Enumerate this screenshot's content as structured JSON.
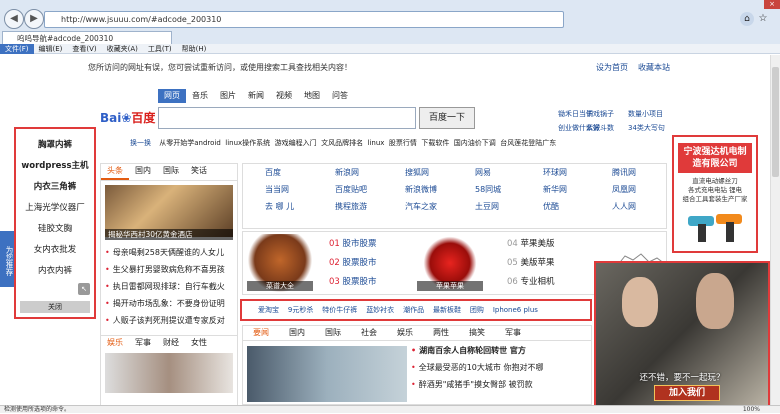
{
  "browser": {
    "url": "http://www.jsuuu.com/#adcode_200310",
    "tab_title": "呜呜导航#adcode_200310",
    "close": "×",
    "menu": [
      "文件(F)",
      "编辑(E)",
      "查看(V)",
      "收藏夹(A)",
      "工具(T)",
      "帮助(H)"
    ],
    "status": "检测使用所选项的命令。",
    "zoom": "100%"
  },
  "notice": "您所访问的网址有误，您可尝试重新访问，或使用搜索工具查找相关内容！",
  "top_links": [
    "设为首页",
    "收藏本站"
  ],
  "search": {
    "tabs": [
      "网页",
      "音乐",
      "图片",
      "新闻",
      "视频",
      "地图",
      "问答"
    ],
    "button": "百度一下",
    "logo": "百度",
    "side": [
      "锄禾日当午",
      "调戏锅子",
      "数量小项目",
      "创业做什么好",
      "紫微斗数",
      "34类大写句"
    ],
    "hot_label": "换一换",
    "hot": [
      "从零开始学android",
      "linux操作系统",
      "游戏编程入门",
      "文风品牌排名",
      "linux",
      "股票行情",
      "下载软件",
      "国内油价下调",
      "台风莲花登陆广东"
    ]
  },
  "left_ad": {
    "items": [
      "胸罩内裤",
      "wordpress主机",
      "内衣三角裤",
      "上海光学仪器厂",
      "硅胶文胸",
      "女内衣批发",
      "内衣内裤"
    ],
    "close": "关闭"
  },
  "float_tab": "为您推荐",
  "news1": {
    "tabs": [
      "头条",
      "国内",
      "国际",
      "笑话"
    ],
    "caption": "揭秘华西村30亿黄金酒店",
    "items": [
      "母亲喝剩258天俩醒谁的人女儿",
      "生父暴打男婴致病危称不喜男孩",
      "执日雷都网现排球：自行车截火",
      "揭开动市场乱象：不要身份证明",
      "人贩子该判死刑提议遭专家反对"
    ]
  },
  "news2": {
    "tabs": [
      "娱乐",
      "军事",
      "财经",
      "女性"
    ]
  },
  "sites": [
    [
      "百度",
      "新浪网",
      "搜狐网",
      "网易",
      "环球网",
      "腾讯网"
    ],
    [
      "当当网",
      "百度贴吧",
      "新浪微博",
      "58同城",
      "新华网",
      "凤凰网"
    ],
    [
      "去 哪 儿",
      "携程旅游",
      "汽车之家",
      "土豆网",
      "优酷",
      "人人网"
    ]
  ],
  "promo": {
    "items": [
      {
        "n": "01",
        "t": "股市股票"
      },
      {
        "n": "02",
        "t": "股票股市"
      },
      {
        "n": "03",
        "t": "股票股市"
      }
    ],
    "items2": [
      {
        "n": "04",
        "t": "苹果美版"
      },
      {
        "n": "05",
        "t": "美版苹果"
      },
      {
        "n": "06",
        "t": "专业相机"
      }
    ],
    "cap1": "菜谱大全",
    "cap2": "苹果苹果"
  },
  "links_bar": [
    "爱淘宝",
    "9元秒杀",
    "特价牛仔裤",
    "蓝妙衬衣",
    "潮作品",
    "最新板鞋",
    "团购",
    "Iphone6 plus"
  ],
  "news3": {
    "tabs": [
      "要闻",
      "国内",
      "国际",
      "社会",
      "娱乐",
      "两性",
      "搞笑",
      "军事"
    ],
    "items": [
      "湖南百余人自称轮回转世 官方",
      "全球最受恶的10大城市 你抱对不哪",
      "醉酒男\"咸猪手\"摸女臀部 被罚款"
    ]
  },
  "right_ad": {
    "title": "宁波强达机电制造有限公司",
    "lines": [
      "直流电动螺丝刀",
      "各式充电电钻 锂电",
      "组合工具套装生产厂家"
    ]
  },
  "video_ad": {
    "subtitle": "还不错，要不一起玩？",
    "button": "加入我们"
  },
  "colors": {
    "highlight": "#e03a3a",
    "link": "#1b4a94",
    "accent": "#3d71c1",
    "tab_active": "#e35b11"
  }
}
